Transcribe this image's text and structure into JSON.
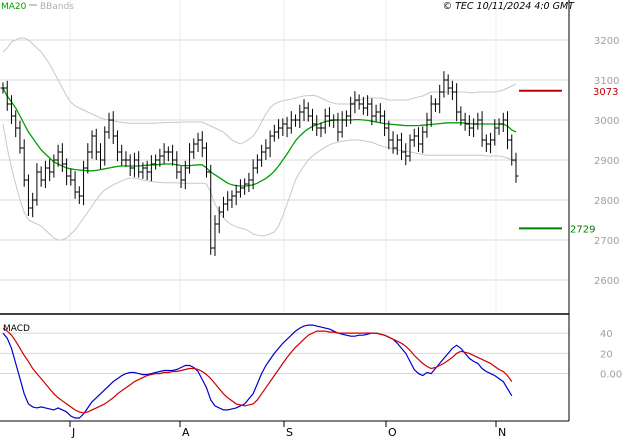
{
  "header": {
    "legend_ma": "MA20",
    "legend_bb": "BBands",
    "source": "© TEC 10/11/2024 4:0 GMT"
  },
  "colors": {
    "price": "#000000",
    "ma20": "#00a000",
    "bbands": "#c8c8c8",
    "resistance": "#c00000",
    "support": "#008000",
    "macd": "#0000cc",
    "signal": "#cc0000",
    "grid": "#d8d8d8",
    "axis_text": "#a0a0a0",
    "axis_frame": "#000000"
  },
  "chart_data": [
    {
      "type": "ohlc",
      "x_labels": [
        "J",
        "A",
        "S",
        "O",
        "N"
      ],
      "y_ticks": [
        2600,
        2700,
        2800,
        2900,
        3000,
        3100,
        3200
      ],
      "ylim": [
        2520,
        3265
      ],
      "levels": [
        {
          "value": 3073,
          "label": "3073",
          "role": "resistance"
        },
        {
          "value": 2729,
          "label": "2729",
          "role": "support"
        }
      ],
      "price": [
        3080,
        3040,
        3010,
        2980,
        2930,
        2850,
        2780,
        2800,
        2870,
        2850,
        2880,
        2870,
        2900,
        2920,
        2890,
        2860,
        2850,
        2820,
        2810,
        2880,
        2920,
        2960,
        2920,
        2900,
        2970,
        3000,
        2960,
        2920,
        2900,
        2900,
        2880,
        2900,
        2870,
        2880,
        2870,
        2890,
        2900,
        2910,
        2920,
        2920,
        2900,
        2870,
        2850,
        2880,
        2920,
        2940,
        2950,
        2930,
        2870,
        2680,
        2740,
        2770,
        2790,
        2800,
        2810,
        2820,
        2830,
        2840,
        2850,
        2880,
        2900,
        2920,
        2930,
        2960,
        2970,
        2980,
        2990,
        2980,
        3000,
        3000,
        3020,
        3030,
        3010,
        2990,
        2980,
        2980,
        3010,
        3000,
        3000,
        2970,
        3000,
        3010,
        3040,
        3050,
        3040,
        3030,
        3040,
        3010,
        3020,
        3010,
        2980,
        2950,
        2930,
        2950,
        2920,
        2910,
        2950,
        2960,
        2940,
        2970,
        3000,
        3040,
        3040,
        3070,
        3100,
        3080,
        3070,
        3020,
        3000,
        2990,
        2980,
        2990,
        3000,
        2950,
        2940,
        2950,
        2980,
        2990,
        3000,
        2950,
        2900,
        2860
      ],
      "ma20": [
        3080,
        3060,
        3045,
        3030,
        3010,
        2990,
        2970,
        2955,
        2940,
        2925,
        2915,
        2905,
        2895,
        2890,
        2885,
        2880,
        2878,
        2876,
        2875,
        2874,
        2873,
        2873,
        2874,
        2876,
        2878,
        2880,
        2882,
        2884,
        2885,
        2885,
        2885,
        2885,
        2885,
        2886,
        2887,
        2888,
        2888,
        2889,
        2890,
        2890,
        2890,
        2888,
        2886,
        2886,
        2886,
        2887,
        2888,
        2888,
        2880,
        2870,
        2863,
        2856,
        2849,
        2842,
        2838,
        2836,
        2835,
        2835,
        2836,
        2838,
        2842,
        2848,
        2854,
        2862,
        2872,
        2885,
        2900,
        2915,
        2932,
        2948,
        2960,
        2970,
        2978,
        2984,
        2988,
        2992,
        2996,
        2998,
        3000,
        3000,
        3000,
        3000,
        3000,
        3001,
        3001,
        3000,
        2999,
        2997,
        2995,
        2993,
        2991,
        2990,
        2989,
        2988,
        2987,
        2986,
        2986,
        2986,
        2986,
        2987,
        2988,
        2989,
        2990,
        2991,
        2992,
        2993,
        2993,
        2993,
        2993,
        2992,
        2991,
        2990,
        2990,
        2990,
        2990,
        2990,
        2990,
        2990,
        2990,
        2985,
        2975,
        2970
      ],
      "bb_upper": [
        3170,
        3180,
        3195,
        3200,
        3205,
        3205,
        3200,
        3190,
        3180,
        3170,
        3155,
        3140,
        3120,
        3100,
        3080,
        3060,
        3045,
        3035,
        3030,
        3025,
        3020,
        3015,
        3010,
        3005,
        3002,
        3000,
        2998,
        2996,
        2994,
        2993,
        2992,
        2992,
        2992,
        2992,
        2992,
        2992,
        2992,
        2993,
        2993,
        2994,
        2994,
        2994,
        2995,
        2995,
        2995,
        2995,
        2995,
        2995,
        2990,
        2985,
        2980,
        2975,
        2970,
        2960,
        2950,
        2945,
        2940,
        2945,
        2952,
        2960,
        2975,
        2995,
        3015,
        3030,
        3040,
        3045,
        3048,
        3050,
        3052,
        3055,
        3058,
        3060,
        3061,
        3062,
        3060,
        3055,
        3050,
        3045,
        3042,
        3040,
        3040,
        3040,
        3040,
        3045,
        3050,
        3052,
        3055,
        3055,
        3055,
        3055,
        3053,
        3050,
        3050,
        3050,
        3050,
        3050,
        3052,
        3055,
        3058,
        3060,
        3065,
        3070,
        3070,
        3070,
        3070,
        3070,
        3070,
        3070,
        3070,
        3070,
        3068,
        3068,
        3070,
        3070,
        3070,
        3070,
        3070,
        3072,
        3075,
        3080,
        3085,
        3090
      ],
      "bb_lower": [
        2990,
        2930,
        2880,
        2840,
        2800,
        2770,
        2750,
        2745,
        2740,
        2735,
        2725,
        2715,
        2705,
        2700,
        2700,
        2705,
        2715,
        2725,
        2740,
        2755,
        2770,
        2785,
        2800,
        2815,
        2825,
        2832,
        2838,
        2843,
        2848,
        2852,
        2855,
        2855,
        2853,
        2850,
        2848,
        2846,
        2845,
        2844,
        2843,
        2843,
        2843,
        2843,
        2842,
        2842,
        2842,
        2842,
        2842,
        2842,
        2840,
        2820,
        2790,
        2770,
        2755,
        2745,
        2738,
        2733,
        2730,
        2727,
        2722,
        2715,
        2712,
        2710,
        2712,
        2715,
        2720,
        2735,
        2760,
        2790,
        2820,
        2850,
        2870,
        2885,
        2900,
        2910,
        2918,
        2925,
        2932,
        2938,
        2942,
        2945,
        2947,
        2948,
        2950,
        2950,
        2950,
        2948,
        2946,
        2944,
        2940,
        2936,
        2933,
        2930,
        2928,
        2926,
        2924,
        2922,
        2920,
        2918,
        2916,
        2914,
        2912,
        2912,
        2912,
        2912,
        2912,
        2912,
        2912,
        2912,
        2912,
        2912,
        2912,
        2912,
        2912,
        2912,
        2910,
        2910,
        2910,
        2910,
        2908,
        2905,
        2900,
        2895
      ]
    },
    {
      "type": "line",
      "title": "MACD",
      "y_ticks": [
        0,
        20,
        40
      ],
      "y_tick_labels": [
        "0.00",
        "20",
        "40"
      ],
      "ylim": [
        -45,
        55
      ],
      "series": [
        {
          "role": "macd",
          "values": [
            40,
            35,
            25,
            10,
            -5,
            -20,
            -30,
            -33,
            -34,
            -33,
            -34,
            -35,
            -36,
            -34,
            -36,
            -38,
            -42,
            -44,
            -44,
            -40,
            -34,
            -28,
            -24,
            -20,
            -16,
            -12,
            -8,
            -5,
            -2,
            0,
            1,
            1,
            0,
            -1,
            -1,
            0,
            1,
            2,
            3,
            3,
            3,
            4,
            6,
            8,
            8,
            6,
            2,
            -6,
            -14,
            -26,
            -32,
            -34,
            -36,
            -36,
            -35,
            -34,
            -32,
            -30,
            -25,
            -20,
            -10,
            0,
            8,
            14,
            20,
            25,
            30,
            34,
            38,
            42,
            45,
            47,
            48,
            48,
            47,
            46,
            45,
            44,
            42,
            40,
            39,
            38,
            37,
            37,
            38,
            38,
            39,
            40,
            40,
            39,
            38,
            36,
            34,
            30,
            25,
            20,
            12,
            4,
            0,
            -2,
            1,
            0,
            5,
            10,
            15,
            20,
            25,
            28,
            25,
            20,
            15,
            12,
            10,
            5,
            2,
            0,
            -2,
            -5,
            -8,
            -15,
            -22
          ]
        },
        {
          "role": "signal",
          "values": [
            45,
            42,
            38,
            32,
            25,
            18,
            12,
            5,
            0,
            -5,
            -10,
            -15,
            -20,
            -24,
            -27,
            -30,
            -33,
            -36,
            -38,
            -39,
            -38,
            -36,
            -34,
            -32,
            -30,
            -27,
            -24,
            -20,
            -17,
            -14,
            -11,
            -8,
            -6,
            -4,
            -2,
            -1,
            0,
            0,
            1,
            1,
            2,
            2,
            3,
            4,
            5,
            5,
            4,
            2,
            -1,
            -5,
            -10,
            -15,
            -20,
            -24,
            -27,
            -30,
            -31,
            -32,
            -31,
            -30,
            -26,
            -20,
            -14,
            -8,
            -2,
            4,
            10,
            16,
            21,
            26,
            30,
            34,
            38,
            40,
            42,
            42,
            42,
            41,
            41,
            40,
            40,
            40,
            40,
            40,
            40,
            40,
            40,
            40,
            40,
            39,
            38,
            36,
            34,
            32,
            30,
            27,
            23,
            18,
            14,
            10,
            7,
            5,
            6,
            8,
            10,
            13,
            16,
            20,
            22,
            21,
            20,
            18,
            16,
            14,
            12,
            10,
            7,
            4,
            2,
            -2,
            -8
          ]
        }
      ]
    }
  ]
}
